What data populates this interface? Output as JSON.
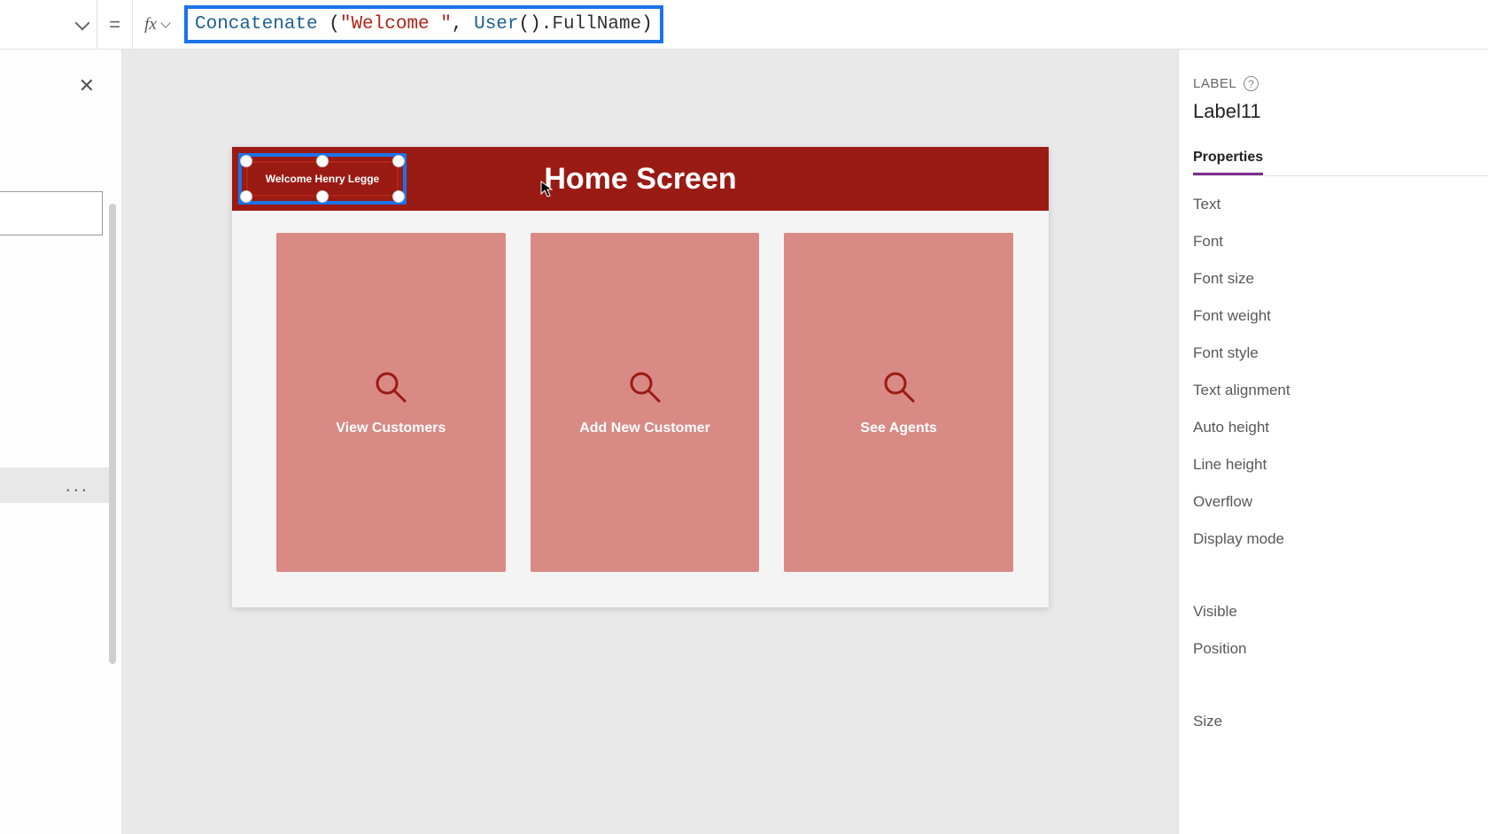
{
  "formula_bar": {
    "fx_label": "fx",
    "equals": "=",
    "formula": {
      "func": "Concatenate ",
      "open": "(",
      "str": "\"Welcome \"",
      "comma": ", ",
      "obj": "User",
      "call_open": "(",
      "call_close": ")",
      "dot": ".",
      "prop": "FullName",
      "close": ")"
    }
  },
  "left_panel": {
    "selected_item_more": "..."
  },
  "canvas": {
    "header_title": "Home Screen",
    "selected_label_text": "Welcome Henry Legge",
    "tiles": [
      {
        "label": "View Customers"
      },
      {
        "label": "Add New Customer"
      },
      {
        "label": "See Agents"
      }
    ]
  },
  "props_panel": {
    "type_label": "LABEL",
    "control_name": "Label11",
    "active_tab": "Properties",
    "properties": [
      "Text",
      "Font",
      "Font size",
      "Font weight",
      "Font style",
      "Text alignment",
      "Auto height",
      "Line height",
      "Overflow",
      "Display mode"
    ],
    "properties_group2": [
      "Visible",
      "Position"
    ],
    "properties_group3": [
      "Size"
    ]
  }
}
